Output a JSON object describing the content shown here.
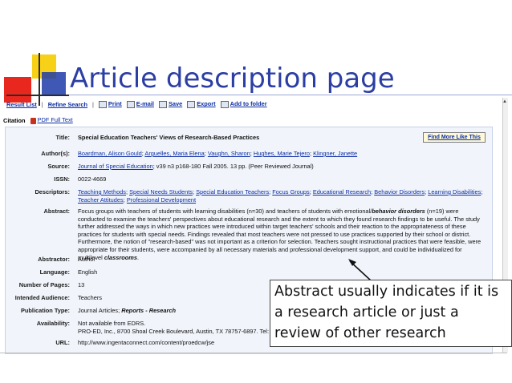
{
  "slide": {
    "title": "Article description page",
    "callout": [
      "Abstract usually indicates if it is",
      "a research article or just a",
      "review of other research"
    ]
  },
  "toolbar": {
    "result_list": "Result List",
    "refine_search": "Refine Search",
    "print": "Print",
    "email": "E-mail",
    "save": "Save",
    "export": "Export",
    "add_to_folder": "Add to folder"
  },
  "citation": {
    "label": "Citation",
    "pdf": "PDF Full Text"
  },
  "find_more": "Find More Like This",
  "record": {
    "title_label": "Title:",
    "title": "Special Education Teachers' Views of Research-Based Practices",
    "authors_label": "Author(s):",
    "authors": [
      "Boardman, Alison Gould",
      "Arguelles, Maria Elena",
      "Vaughn, Sharon",
      "Hughes, Marie Tejero",
      "Klingner, Janette"
    ],
    "source_label": "Source:",
    "source_journal": "Journal of Special Education",
    "source_rest": "; v39 n3 p168-180 Fall 2005. 13 pp. (Peer Reviewed Journal)",
    "issn_label": "ISSN:",
    "issn": "0022-4669",
    "descriptors_label": "Descriptors:",
    "descriptors": [
      "Teaching Methods",
      "Special Needs Students",
      "Special Education Teachers",
      "Focus Groups",
      "Educational Research",
      "Behavior Disorders",
      "Learning Disabilities",
      "Teacher Attitudes",
      "Professional Development"
    ],
    "abstract_label": "Abstract:",
    "abstract_p1": "Focus groups with teachers of students with learning disabilities (n=30) and teachers of students with emotional/",
    "abstract_em1": "behavior disorders",
    "abstract_p2": " (n=19) were conducted to examine the teachers' perspectives about educational research and the extent to which they found research findings to be useful. The study further addressed the ways in which new practices were introduced within target teachers' schools and their reaction to the appropriateness of these practices for students with special needs. Findings revealed that most teachers were not pressed to use practices supported by their school or district. Furthermore, the notion of \"research-based\" was not important as a criterion for selection. Teachers sought instructional practices that were feasible, were appropriate for their students, were accompanied by all necessary materials and professional development support, and could be individualized for multilevel ",
    "abstract_em2": "classrooms",
    "abstract_end": ".",
    "abstractor_label": "Abstractor:",
    "abstractor": "Author",
    "language_label": "Language:",
    "language": "English",
    "pages_label": "Number of Pages:",
    "pages": "13",
    "audience_label": "Intended Audience:",
    "audience": "Teachers",
    "pubtype_label": "Publication Type:",
    "pubtype_a": "Journal Articles; ",
    "pubtype_b": "Reports - Research",
    "availability_label": "Availability:",
    "availability_1": "Not available from EDRS.",
    "availability_2": "PRO-ED, Inc., 8700 Shoal Creek Boulevard, Austin, TX 78757-6897. Tel: 800-",
    "url_label": "URL:",
    "url": "http://www.ingentaconnect.com/content/proedcw/jse"
  },
  "colors": {
    "slide_title": "#2b3ea3",
    "link": "#0b2ea4",
    "record_bg": "#f1f5fb",
    "yellow": "#f7d117",
    "red": "#e8281e",
    "blue": "#1f3ba8"
  }
}
